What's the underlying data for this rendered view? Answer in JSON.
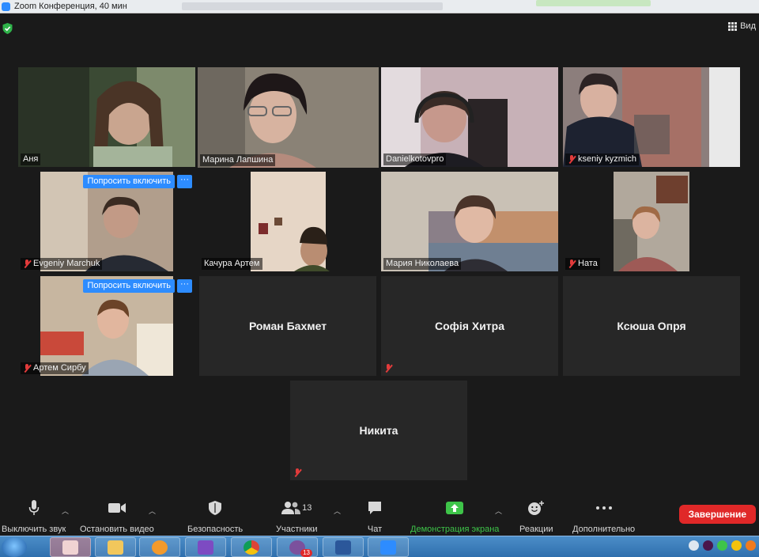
{
  "window": {
    "title": "Zoom Конференция, 40 мин"
  },
  "top_controls": {
    "view_label": "Вид"
  },
  "tiles": [
    {
      "name": "Аня",
      "muted": false,
      "video": true,
      "active": false
    },
    {
      "name": "Марина Лапшина",
      "muted": false,
      "video": true,
      "active": true
    },
    {
      "name": "Danielkotovpro",
      "muted": false,
      "video": true,
      "active": false
    },
    {
      "name": "kseniy kyzmich",
      "muted": true,
      "video": true,
      "active": false
    },
    {
      "name": "Evgeniy Marchuk",
      "muted": true,
      "video": true,
      "active": false,
      "ask_label": "Попросить включить",
      "more_label": "···"
    },
    {
      "name": "Качура Артем",
      "muted": false,
      "video": true,
      "active": false
    },
    {
      "name": "Мария Николаева",
      "muted": false,
      "video": true,
      "active": false
    },
    {
      "name": "Ната",
      "muted": true,
      "video": true,
      "active": false
    },
    {
      "name": "Артем Сирбу",
      "muted": true,
      "video": true,
      "active": false,
      "ask_label": "Попросить включить",
      "more_label": "···"
    },
    {
      "name": "Роман Бахмет",
      "muted": false,
      "video": false,
      "active": false
    },
    {
      "name": "Софія Хитра",
      "muted": true,
      "video": false,
      "active": false
    },
    {
      "name": "Ксюша Опря",
      "muted": false,
      "video": false,
      "active": false
    },
    {
      "name": "Никита",
      "muted": true,
      "video": false,
      "active": false
    }
  ],
  "toolbar": {
    "mute_label": "Выключить звук",
    "video_label": "Остановить видео",
    "security_label": "Безопасность",
    "participants_label": "Участники",
    "participants_count": "13",
    "chat_label": "Чат",
    "share_label": "Демонстрация экрана",
    "reactions_label": "Реакции",
    "more_label": "Дополнительно",
    "end_label": "Завершение"
  },
  "taskbar": {
    "viber_badge": "13"
  },
  "colors": {
    "accent": "#2d8cff",
    "active_border": "#c5e06a",
    "share_green": "#3ec449",
    "end_red": "#e02828"
  }
}
